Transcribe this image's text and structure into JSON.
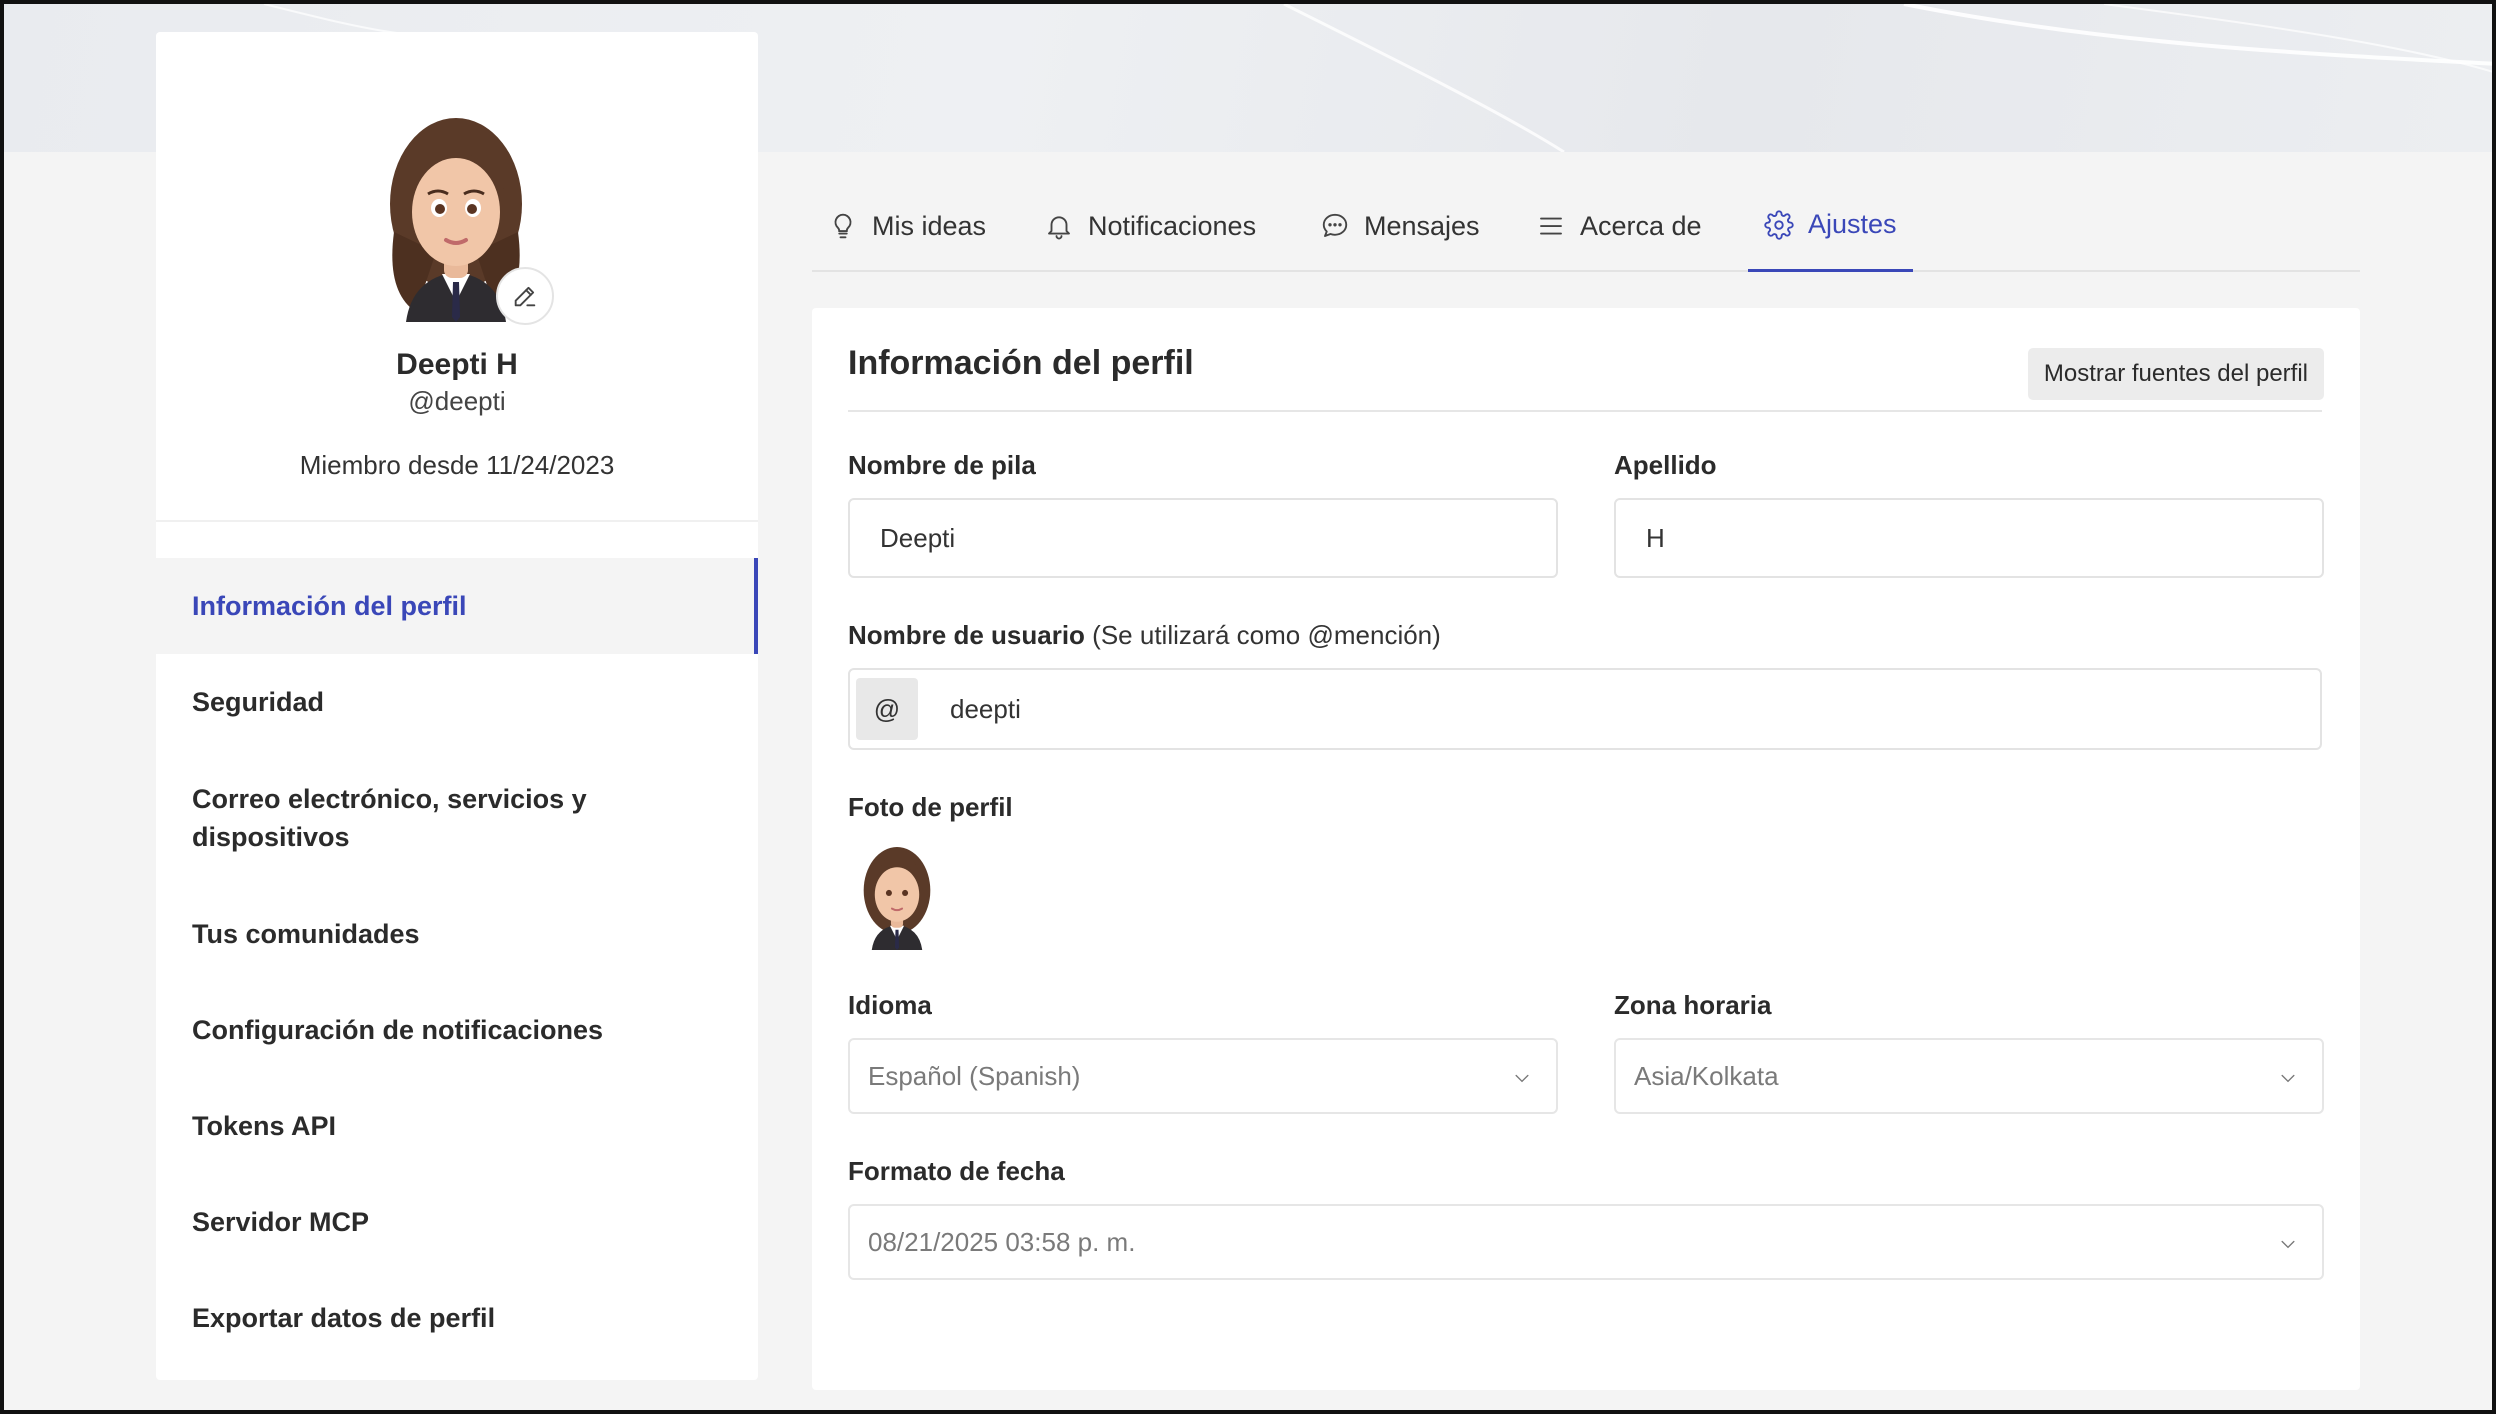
{
  "profile": {
    "name": "Deepti H",
    "handle": "@deepti",
    "member_since": "Miembro desde 11/24/2023"
  },
  "sidebar": {
    "items": [
      {
        "label": "Información del perfil",
        "active": true
      },
      {
        "label": "Seguridad"
      },
      {
        "label": "Correo electrónico, servicios y dispositivos"
      },
      {
        "label": "Tus comunidades"
      },
      {
        "label": "Configuración de notificaciones"
      },
      {
        "label": "Tokens API"
      },
      {
        "label": "Servidor MCP"
      },
      {
        "label": "Exportar datos de perfil"
      }
    ]
  },
  "tabs": [
    {
      "label": "Mis ideas",
      "icon": "lightbulb-icon"
    },
    {
      "label": "Notificaciones",
      "icon": "bell-icon"
    },
    {
      "label": "Mensajes",
      "icon": "chat-bubble-icon"
    },
    {
      "label": "Acerca de",
      "icon": "menu-lines-icon"
    },
    {
      "label": "Ajustes",
      "icon": "gear-icon",
      "active": true
    }
  ],
  "form": {
    "title": "Información del perfil",
    "sources_button": "Mostrar fuentes del perfil",
    "first_name_label": "Nombre de pila",
    "first_name_value": "Deepti",
    "last_name_label": "Apellido",
    "last_name_value": "H",
    "username_label": "Nombre de usuario",
    "username_note": "(Se utilizará como @mención)",
    "username_prefix": "@",
    "username_value": "deepti",
    "photo_label": "Foto de perfil",
    "language_label": "Idioma",
    "language_value": "Español (Spanish)",
    "timezone_label": "Zona horaria",
    "timezone_value": "Asia/Kolkata",
    "date_format_label": "Formato de fecha",
    "date_format_value": "08/21/2025 03:58 p. m."
  },
  "colors": {
    "accent": "#3a47b8",
    "page_bg": "#f4f4f4"
  }
}
